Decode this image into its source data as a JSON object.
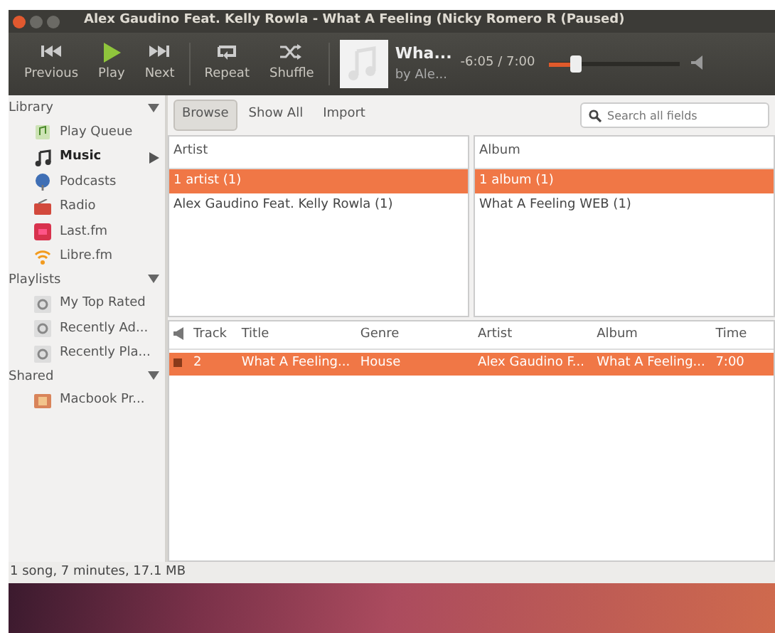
{
  "window": {
    "title": "Alex Gaudino Feat. Kelly Rowla - What A Feeling (Nicky Romero R (Paused)"
  },
  "toolbar": [
    {
      "label": "Previous",
      "kind": "previous"
    },
    {
      "label": "Play",
      "kind": "play"
    },
    {
      "label": "Next",
      "kind": "next"
    },
    {
      "label": "Repeat",
      "kind": "repeat"
    },
    {
      "label": "Shuffle",
      "kind": "shuffle"
    }
  ],
  "now_playing": {
    "title": "Wha...",
    "artist": "by Ale...",
    "time": "-6:05 / 7:00",
    "level": 0.18
  },
  "sidebar": [
    {
      "label": "Library",
      "expanded": true,
      "items": [
        {
          "label": "Play Queue",
          "kind": "queue",
          "selected": false
        },
        {
          "label": "Music",
          "kind": "music",
          "selected": true
        },
        {
          "label": "Podcasts",
          "kind": "podcast",
          "selected": false
        },
        {
          "label": "Radio",
          "kind": "radio",
          "selected": false
        },
        {
          "label": "Last.fm",
          "kind": "lastfm",
          "selected": false
        },
        {
          "label": "Libre.fm",
          "kind": "librefm",
          "selected": false
        }
      ]
    },
    {
      "label": "Playlists",
      "expanded": true,
      "items": [
        {
          "label": "My Top Rated",
          "kind": "playlist",
          "selected": false
        },
        {
          "label": "Recently Ad...",
          "kind": "playlist",
          "selected": false
        },
        {
          "label": "Recently Pla...",
          "kind": "playlist",
          "selected": false
        }
      ]
    },
    {
      "label": "Shared",
      "expanded": true,
      "items": [
        {
          "label": "Macbook Pr...",
          "kind": "device",
          "selected": false
        }
      ]
    }
  ],
  "view_tabs": [
    {
      "label": "Browse",
      "selected": true
    },
    {
      "label": "Show All",
      "selected": false
    },
    {
      "label": "Import",
      "selected": false
    }
  ],
  "search": {
    "placeholder": "Search all fields"
  },
  "browser": [
    {
      "heading": "Artist",
      "rows": [
        {
          "text": "1 artist (1)",
          "selected": true
        },
        {
          "text": "Alex Gaudino Feat. Kelly Rowla (1)",
          "selected": false
        }
      ]
    },
    {
      "heading": "Album",
      "rows": [
        {
          "text": "1 album (1)",
          "selected": true
        },
        {
          "text": "What A Feeling WEB (1)",
          "selected": false
        }
      ]
    }
  ],
  "tracks": {
    "columns": [
      "Track",
      "Title",
      "Genre",
      "Artist",
      "Album",
      "Time"
    ],
    "rows": [
      {
        "selected": true,
        "playing": true,
        "cells": [
          "2",
          "What A Feeling...",
          "House",
          "Alex Gaudino F...",
          "What A Feeling...",
          "7:00"
        ]
      }
    ]
  },
  "status_bar": "1 song, 7 minutes, 17.1 MB"
}
